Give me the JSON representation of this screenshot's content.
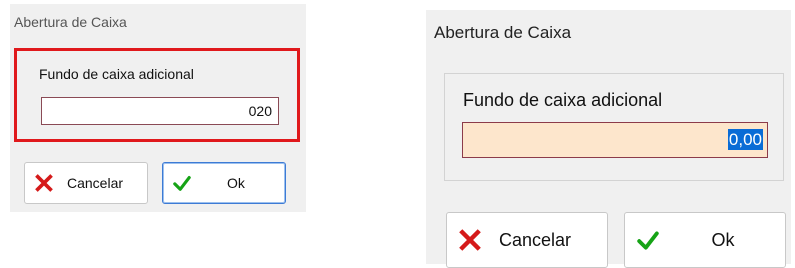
{
  "dialog_before": {
    "title": "Abertura de Caixa",
    "field_label": "Fundo de caixa adicional",
    "field_value": "020",
    "cancel_label": "Cancelar",
    "ok_label": "Ok",
    "highlight_color": "#e0191c",
    "cancel_icon": "x-icon",
    "ok_icon": "checkmark-icon"
  },
  "dialog_after": {
    "title": "Abertura de Caixa",
    "field_label": "Fundo de caixa adicional",
    "field_value": "0,00",
    "field_background": "#fde6cc",
    "selection_color": "#0a6cd6",
    "cancel_label": "Cancelar",
    "ok_label": "Ok",
    "cancel_icon": "x-icon",
    "ok_icon": "checkmark-icon"
  }
}
